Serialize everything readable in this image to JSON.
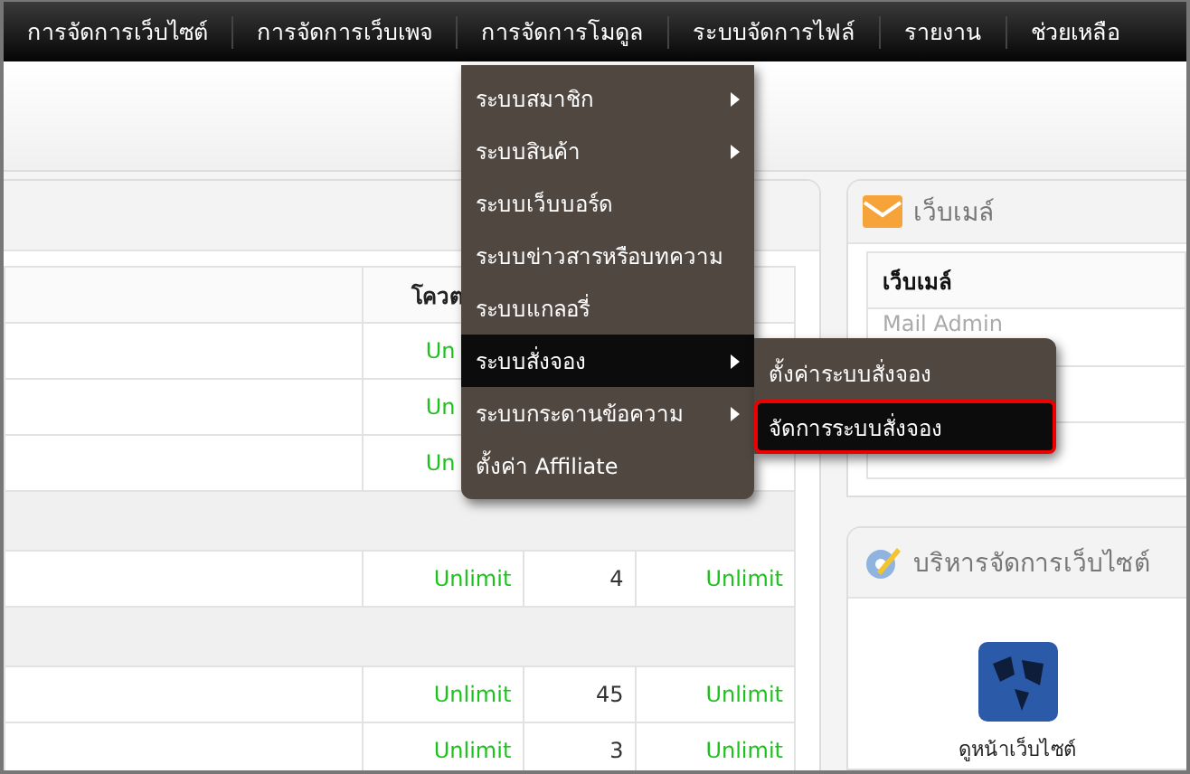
{
  "nav": [
    {
      "label": "การจัดการเว็บไซต์"
    },
    {
      "label": "การจัดการเว็บเพจ"
    },
    {
      "label": "การจัดการโมดูล"
    },
    {
      "label": "ระบบจัดการไฟล์"
    },
    {
      "label": "รายงาน"
    },
    {
      "label": "ช่วยเหลือ"
    }
  ],
  "dropdown": {
    "items": [
      {
        "label": "ระบบสมาชิก",
        "has_submenu": true,
        "selected": false
      },
      {
        "label": "ระบบสินค้า",
        "has_submenu": true,
        "selected": false
      },
      {
        "label": "ระบบเว็บบอร์ด",
        "has_submenu": false,
        "selected": false
      },
      {
        "label": "ระบบข่าวสารหรือบทความ",
        "has_submenu": false,
        "selected": false
      },
      {
        "label": "ระบบแกลอรี่",
        "has_submenu": false,
        "selected": false
      },
      {
        "label": "ระบบสั่งจอง",
        "has_submenu": true,
        "selected": true
      },
      {
        "label": "ระบบกระดานข้อความ",
        "has_submenu": true,
        "selected": false
      },
      {
        "label": "ตั้งค่า Affiliate",
        "has_submenu": false,
        "selected": false
      }
    ],
    "submenu": [
      {
        "label": "ตั้งค่าระบบสั่งจอง",
        "selected": false
      },
      {
        "label": "จัดการระบบสั่งจอง",
        "selected": true
      }
    ]
  },
  "quota_table": {
    "columns": [
      {
        "label": "โควต",
        "partial": true
      }
    ],
    "rows": [
      {
        "kind": "data",
        "quota": "Un",
        "partial": true
      },
      {
        "kind": "data",
        "quota": "Un",
        "partial": true
      },
      {
        "kind": "data",
        "quota": "Un",
        "partial": true
      },
      {
        "kind": "section"
      },
      {
        "kind": "data",
        "quota": "Unlimit",
        "used": "4",
        "left": "Unlimit",
        "partial": false
      },
      {
        "kind": "section"
      },
      {
        "kind": "data",
        "quota": "Unlimit",
        "used": "45",
        "left": "Unlimit",
        "partial": false
      },
      {
        "kind": "data",
        "quota": "Unlimit",
        "used": "3",
        "left": "Unlimit",
        "partial": false
      }
    ]
  },
  "webmail": {
    "title": "เว็บเมล์",
    "column": "เว็บเมล์",
    "rows": [
      "Mail Admin"
    ]
  },
  "admin": {
    "title": "บริหารจัดการเว็บไซต์",
    "shortcuts": [
      {
        "label": "ดูหน้าเว็บไซต์"
      }
    ]
  }
}
